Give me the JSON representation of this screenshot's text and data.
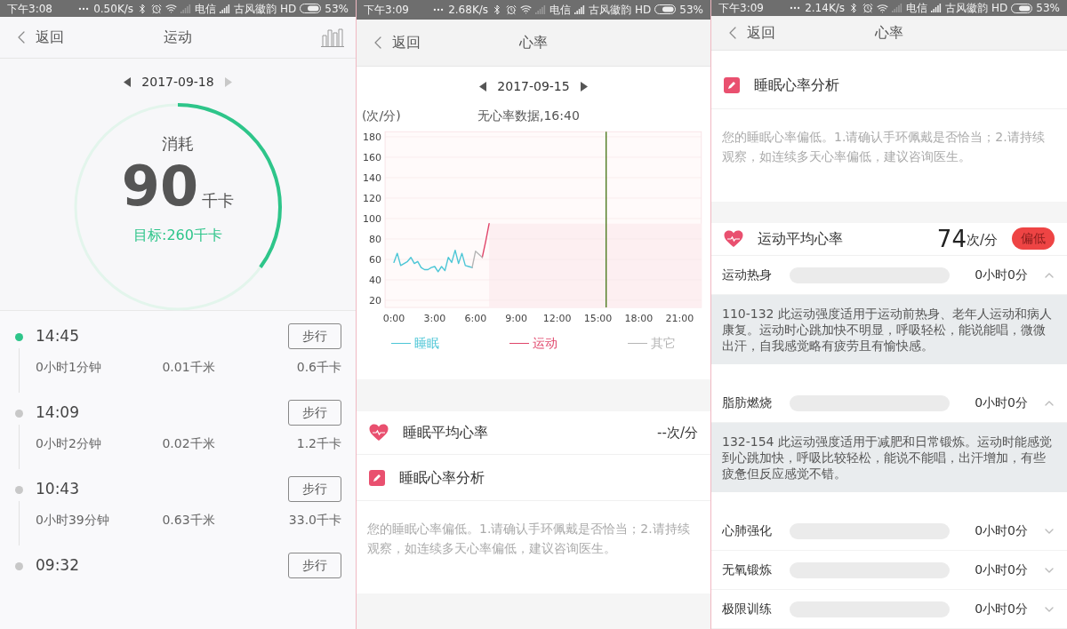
{
  "screens": [
    {
      "kind": "activity",
      "status_bar": {
        "time": "下午3:08",
        "speed": "0.50K/s",
        "carrier": "电信",
        "operator": "古风徽韵",
        "network": "HD",
        "battery": "53%"
      },
      "header": {
        "back": "返回",
        "title": "运动"
      },
      "date_nav": {
        "date": "2017-09-18",
        "next_disabled": true
      },
      "ring": {
        "label": "消耗",
        "value": "90",
        "unit": "千卡",
        "goal": "目标:260千卡",
        "level": 0.35
      },
      "records": [
        {
          "time": "14:45",
          "active": true,
          "type": "步行",
          "duration": "0小时1分钟",
          "distance": "0.01千米",
          "calories": "0.6千卡"
        },
        {
          "time": "14:09",
          "active": false,
          "type": "步行",
          "duration": "0小时2分钟",
          "distance": "0.02千米",
          "calories": "1.2千卡"
        },
        {
          "time": "10:43",
          "active": false,
          "type": "步行",
          "duration": "0小时39分钟",
          "distance": "0.63千米",
          "calories": "33.0千卡"
        },
        {
          "time": "09:32",
          "active": false,
          "type": "步行"
        }
      ]
    },
    {
      "kind": "heart_chart",
      "status_bar": {
        "time": "下午3:09",
        "speed": "2.68K/s",
        "carrier": "电信",
        "operator": "古风徽韵",
        "network": "HD",
        "battery": "53%"
      },
      "header": {
        "back": "返回",
        "title": "心率"
      },
      "date_nav": {
        "date": "2017-09-15",
        "next_disabled": false
      },
      "chart_data": {
        "type": "line",
        "title": "无心率数据,16:40",
        "ylabel": "(次/分)",
        "x": [
          0,
          0.25,
          0.5,
          0.75,
          1,
          1.25,
          1.5,
          1.75,
          2,
          2.25,
          2.5,
          2.75,
          3,
          3.25,
          3.5,
          3.75,
          4,
          4.25,
          4.5,
          4.75,
          5,
          5.25,
          5.5,
          5.75,
          6,
          6.25,
          6.5,
          6.75,
          7
        ],
        "series": [
          {
            "name": "睡眠",
            "color": "#4cc6d6",
            "values": [
              57,
              66,
              54,
              56,
              58,
              62,
              56,
              58,
              52,
              50,
              50,
              52,
              53,
              48,
              53,
              49,
              62,
              57,
              69,
              56,
              66,
              54,
              53,
              52,
              null,
              null,
              null,
              null,
              null
            ]
          },
          {
            "name": "运动",
            "color": "#e0456a",
            "values": [
              null,
              null,
              null,
              null,
              null,
              null,
              null,
              null,
              null,
              null,
              null,
              null,
              null,
              null,
              null,
              null,
              null,
              null,
              null,
              null,
              null,
              null,
              null,
              null,
              null,
              null,
              62,
              78,
              95
            ]
          },
          {
            "name": "其它",
            "color": "#b5b5b5",
            "values": [
              null,
              null,
              null,
              null,
              null,
              null,
              null,
              null,
              null,
              null,
              null,
              null,
              null,
              null,
              null,
              null,
              null,
              null,
              null,
              null,
              null,
              null,
              null,
              52,
              68,
              65,
              62,
              null,
              null
            ]
          }
        ],
        "grid": true,
        "xlim": [
          -0.65,
          22.6
        ],
        "ylim": [
          13,
          185
        ],
        "xticks": [
          {
            "value": 0,
            "label": "0:00"
          },
          {
            "value": 3,
            "label": "3:00"
          },
          {
            "value": 6,
            "label": "6:00"
          },
          {
            "value": 9,
            "label": "9:00"
          },
          {
            "value": 12,
            "label": "12:00"
          },
          {
            "value": 15,
            "label": "15:00"
          },
          {
            "value": 18,
            "label": "18:00"
          },
          {
            "value": 21,
            "label": "21:00"
          }
        ],
        "yticks": [
          20,
          40,
          60,
          80,
          100,
          120,
          140,
          160,
          180
        ],
        "ref_lines": [
          {
            "axis": "x",
            "value": 15.6
          }
        ]
      },
      "average": {
        "title": "睡眠平均心率",
        "value": "--次/分"
      },
      "analysis": {
        "title": "睡眠心率分析",
        "text": "您的睡眠心率偏低。1.请确认手环佩戴是否恰当；2.请持续观察，如连续多天心率偏低，建议咨询医生。"
      }
    },
    {
      "kind": "heart_zones",
      "status_bar": {
        "time": "下午3:09",
        "speed": "2.14K/s",
        "carrier": "电信",
        "operator": "古风徽韵",
        "network": "HD",
        "battery": "53%"
      },
      "header": {
        "back": "返回",
        "title": "心率"
      },
      "analysis": {
        "title": "睡眠心率分析",
        "text": "您的睡眠心率偏低。1.请确认手环佩戴是否恰当；2.请持续观察，如连续多天心率偏低，建议咨询医生。"
      },
      "average": {
        "title": "运动平均心率",
        "value": "74",
        "unit": "次/分",
        "badge": "偏低"
      },
      "zones": [
        {
          "name": "运动热身",
          "level": 0,
          "duration": "0小时0分",
          "expanded": true,
          "description": "110-132 此运动强度适用于运动前热身、老年人运动和病人康复。运动时心跳加快不明显，呼吸轻松，能说能唱，微微出汗，自我感觉略有疲劳且有愉快感。"
        },
        {
          "name": "脂肪燃烧",
          "level": 0,
          "duration": "0小时0分",
          "expanded": true,
          "description": "132-154 此运动强度适用于减肥和日常锻炼。运动时能感觉到心跳加快，呼吸比较轻松，能说不能唱，出汗增加，有些疲惫但反应感觉不错。"
        },
        {
          "name": "心肺强化",
          "level": 0,
          "duration": "0小时0分",
          "expanded": false
        },
        {
          "name": "无氧锻炼",
          "level": 0,
          "duration": "0小时0分",
          "expanded": false
        },
        {
          "name": "极限训练",
          "level": 0,
          "duration": "0小时0分",
          "expanded": false
        }
      ]
    }
  ]
}
